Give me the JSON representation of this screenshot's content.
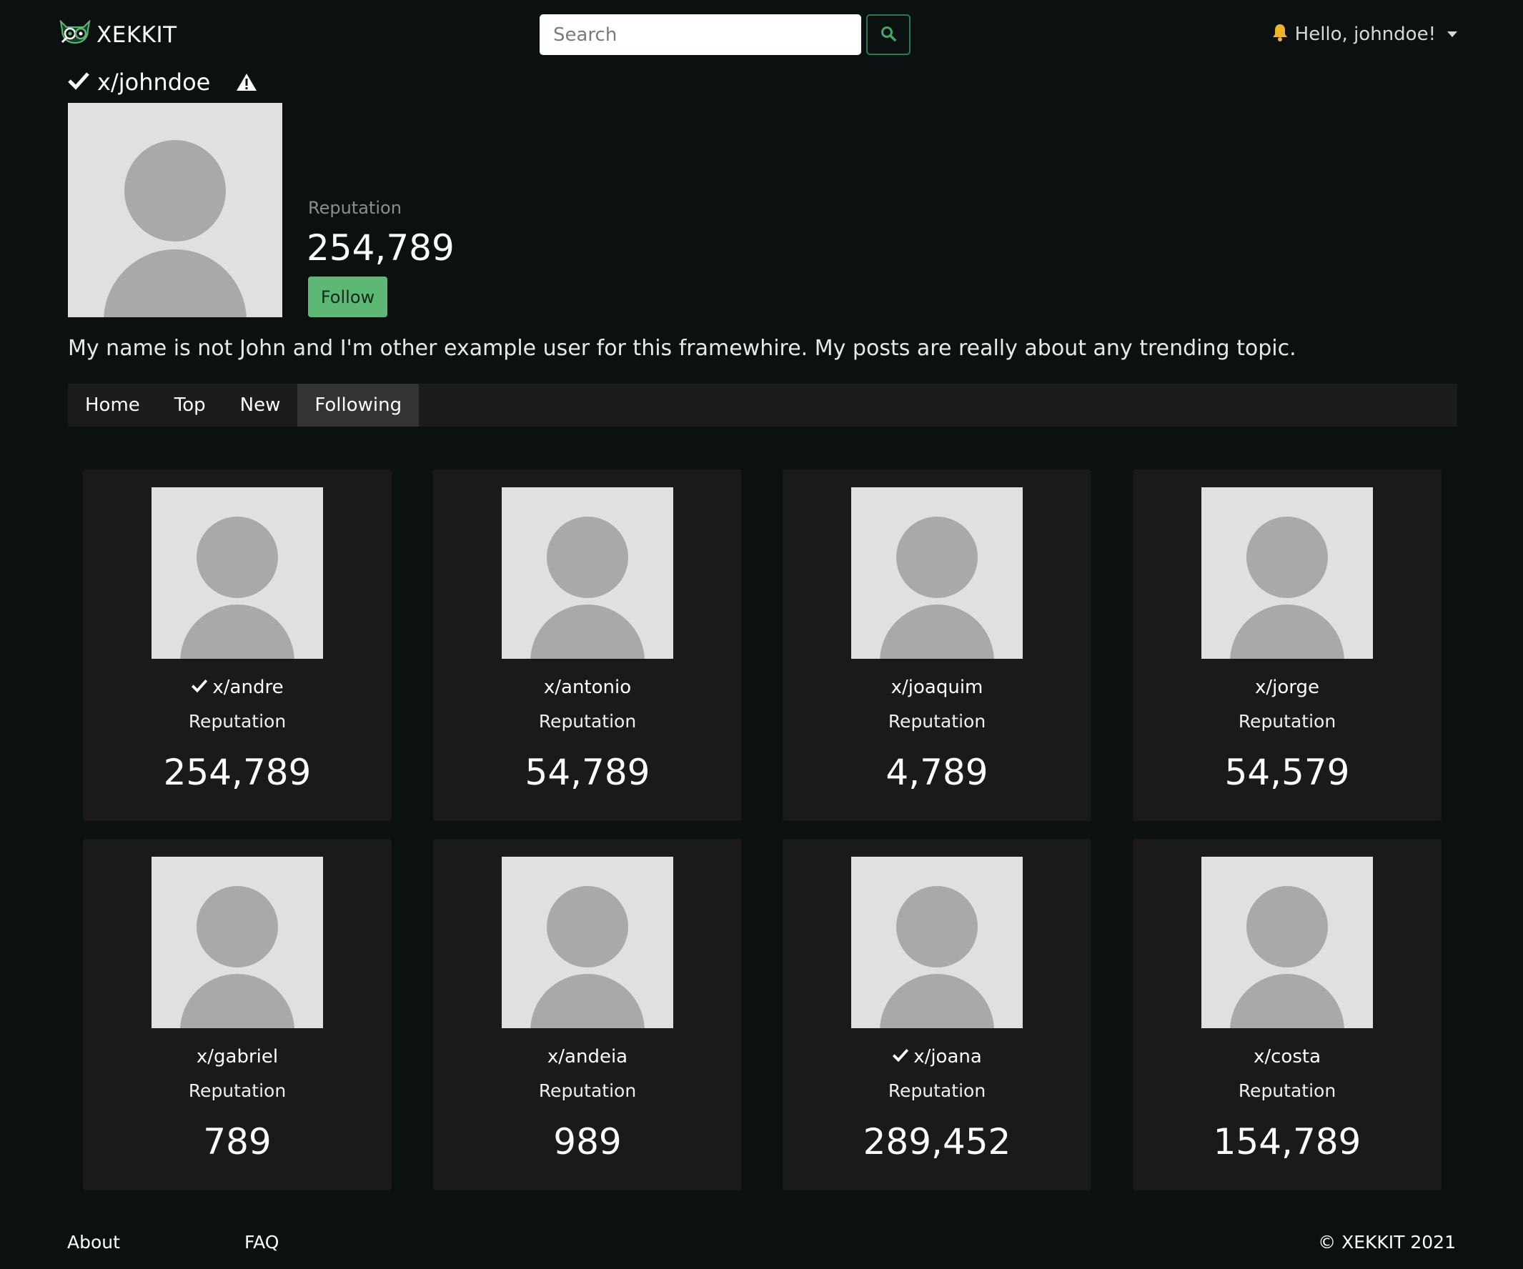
{
  "header": {
    "brand": "XEKKIT",
    "search_placeholder": "Search",
    "greeting": "Hello, johndoe!",
    "accent_color": "#2f7a4a"
  },
  "profile": {
    "username": "x/johndoe",
    "verified": true,
    "reputation_label": "Reputation",
    "reputation": "254,789",
    "follow_label": "Follow",
    "bio": "My name is not John and I'm other example user for this framewhire. My posts are really about any trending topic."
  },
  "tabs": [
    {
      "label": "Home"
    },
    {
      "label": "Top"
    },
    {
      "label": "New"
    },
    {
      "label": "Following",
      "active": true
    }
  ],
  "following": [
    {
      "username": "x/andre",
      "verified": true,
      "reputation_label": "Reputation",
      "reputation": "254,789"
    },
    {
      "username": "x/antonio",
      "verified": false,
      "reputation_label": "Reputation",
      "reputation": "54,789"
    },
    {
      "username": "x/joaquim",
      "verified": false,
      "reputation_label": "Reputation",
      "reputation": "4,789"
    },
    {
      "username": "x/jorge",
      "verified": false,
      "reputation_label": "Reputation",
      "reputation": "54,579"
    },
    {
      "username": "x/gabriel",
      "verified": false,
      "reputation_label": "Reputation",
      "reputation": "789"
    },
    {
      "username": "x/andeia",
      "verified": false,
      "reputation_label": "Reputation",
      "reputation": "989"
    },
    {
      "username": "x/joana",
      "verified": true,
      "reputation_label": "Reputation",
      "reputation": "289,452"
    },
    {
      "username": "x/costa",
      "verified": false,
      "reputation_label": "Reputation",
      "reputation": "154,789"
    }
  ],
  "footer": {
    "about": "About",
    "faq": "FAQ",
    "copyright": "© XEKKIT 2021"
  }
}
